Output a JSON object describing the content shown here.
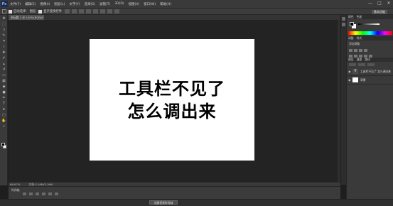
{
  "app": {
    "logo": "Ps"
  },
  "menu": [
    "文件(F)",
    "编辑(E)",
    "图像(I)",
    "图层(L)",
    "文字(Y)",
    "选择(S)",
    "滤镜(T)",
    "3D(D)",
    "视图(V)",
    "窗口(W)",
    "帮助(H)"
  ],
  "window_controls": {
    "minimize": "—",
    "maximize": "□",
    "close": "✕"
  },
  "options_bar": {
    "auto_select_label": "自动选择:",
    "auto_select_value": "图层",
    "show_transform_label": "显示变换控件",
    "workspace": "基本功能"
  },
  "document": {
    "tab_label": "未标题-1 @ 100%(RGB/8)",
    "lines": [
      "工具栏不见了",
      "怎么调出来"
    ]
  },
  "status": {
    "zoom": "66.67%",
    "doc_info": "文档:3.16M/3.16M"
  },
  "timeline": {
    "tab_label": "时间轴",
    "create_button": "创建视频时间轴"
  },
  "panels": {
    "color_tabs": [
      "颜色",
      "色板"
    ],
    "adjust_tabs": [
      "调整",
      "样式"
    ],
    "adjust_label": "添加调整",
    "layers_tabs": [
      "图层",
      "通道",
      "路径"
    ],
    "layers": [
      {
        "thumb": "T",
        "name": "工具栏不见了 怎么调出来"
      },
      {
        "thumb": "",
        "name": "背景"
      }
    ]
  },
  "colors": {
    "accent": "#1b2d52",
    "canvas": "#232323",
    "document": "#ffffff"
  }
}
